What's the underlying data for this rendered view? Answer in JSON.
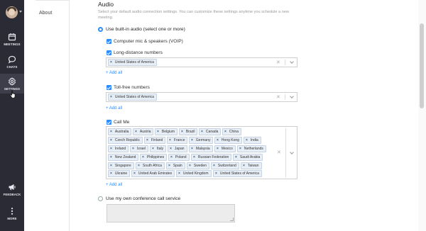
{
  "rail": {
    "items": [
      {
        "label": "MEETINGS",
        "icon": "calendar-icon"
      },
      {
        "label": "CHATS",
        "icon": "chat-bubble-icon"
      },
      {
        "label": "SETTINGS",
        "icon": "gear-icon"
      },
      {
        "label": "FEEDBACK",
        "icon": "megaphone-icon"
      },
      {
        "label": "MORE",
        "icon": "more-vertical-icon"
      }
    ],
    "active": "SETTINGS"
  },
  "subnav": {
    "about": "About"
  },
  "audio": {
    "title": "Audio",
    "description": "Select your default audio connection settings. You can customize these settings anytime you schedule a new meeting.",
    "builtin_label": "Use built-in audio (select one or more)",
    "voip_label": "Computer mic & speakers (VOIP)",
    "long_distance_label": "Long-distance numbers",
    "long_distance_countries": [
      "United States of America"
    ],
    "toll_free_label": "Toll-free numbers",
    "toll_free_countries": [
      "United States of America"
    ],
    "call_me_label": "Call Me",
    "call_me_countries": [
      "Australia",
      "Austria",
      "Belgium",
      "Brazil",
      "Canada",
      "China",
      "Czech Republic",
      "Finland",
      "France",
      "Germany",
      "Hong Kong",
      "India",
      "Ireland",
      "Israel",
      "Italy",
      "Japan",
      "Malaysia",
      "Mexico",
      "Netherlands",
      "New Zealand",
      "Philippines",
      "Poland",
      "Russian Federation",
      "Saudi Arabia",
      "Singapore",
      "South Africa",
      "Spain",
      "Sweden",
      "Switzerland",
      "Taiwan",
      "Ukraine",
      "United Arab Emirates",
      "United Kingdom",
      "United States of America"
    ],
    "add_all": "+ Add all",
    "own_service_label": "Use my own conference call service"
  },
  "colors": {
    "accent": "#2d8cff",
    "rail": "#2b2b35"
  }
}
